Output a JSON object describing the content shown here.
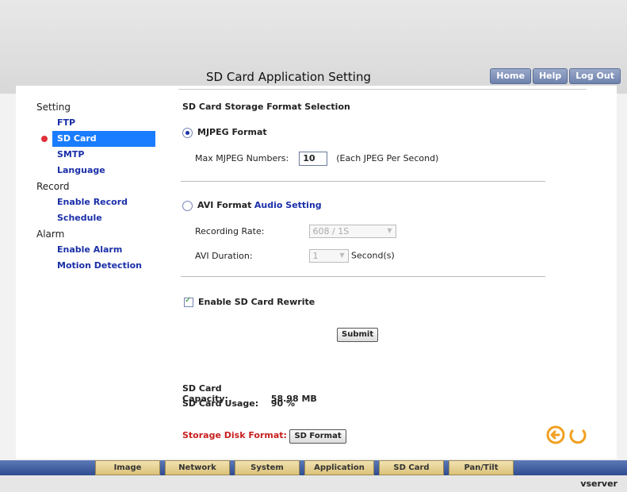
{
  "top_nav": [
    "Home",
    "Help",
    "Log Out"
  ],
  "page_title": "SD Card Application Setting",
  "sidebar": {
    "sections": [
      {
        "label": "Setting",
        "items": [
          "FTP",
          "SD Card",
          "SMTP",
          "Language"
        ]
      },
      {
        "label": "Record",
        "items": [
          "Enable Record",
          "Schedule"
        ]
      },
      {
        "label": "Alarm",
        "items": [
          "Enable Alarm",
          "Motion Detection"
        ]
      }
    ],
    "active": "SD Card"
  },
  "content": {
    "section_caption": "SD Card Storage Format Selection",
    "mjpeg": {
      "label": "MJPEG Format",
      "selected": true,
      "max_label": "Max MJPEG Numbers:",
      "max_value": "10",
      "max_hint": "(Each JPEG Per Second)"
    },
    "avi": {
      "label": "AVI Format",
      "audio_link": "Audio Setting",
      "selected": false,
      "rate_label": "Recording Rate:",
      "rate_value": "608 / 1S",
      "duration_label": "AVI Duration:",
      "duration_value": "1",
      "duration_unit": "Second(s)"
    },
    "rewrite_label": "Enable SD Card Rewrite",
    "rewrite_checked": true,
    "submit_label": "Submit",
    "capacity_label": "SD Card Capacity:",
    "capacity_value": "58.98 MB",
    "usage_label": "SD Card Usage:",
    "usage_value": "90 %",
    "format_label": "Storage Disk Format:",
    "format_button": "SD Format"
  },
  "bottom_tabs": [
    "Image",
    "Network",
    "System",
    "Application",
    "SD Card",
    "Pan/Tilt"
  ],
  "brand": "vserver",
  "icons": [
    "back-icon",
    "refresh-icon"
  ],
  "colors": {
    "accent": "#1a7cff",
    "link": "#1a2fa8",
    "warning": "#c81f1f",
    "tab_bg": "#dcc27a",
    "nav_bar": "#2f4d8f",
    "icon_orange": "#f0a020"
  }
}
